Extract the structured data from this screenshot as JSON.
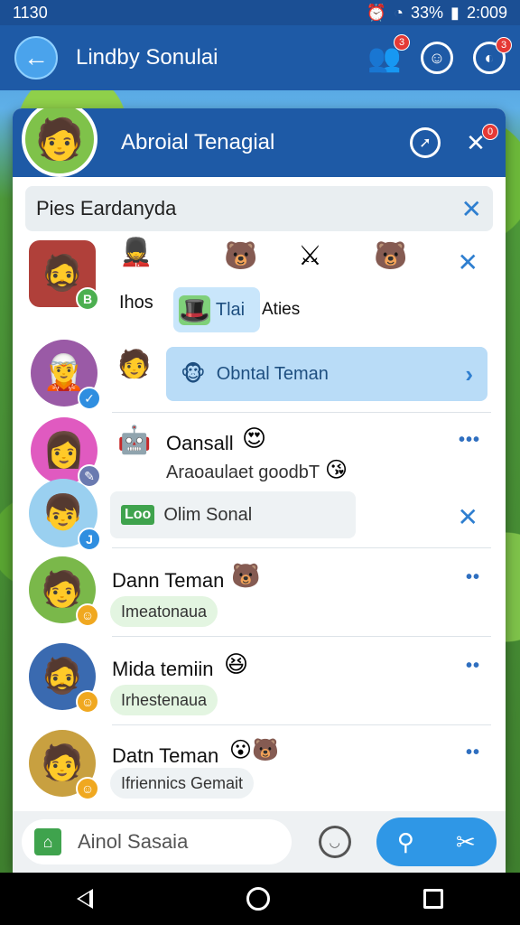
{
  "status": {
    "time": "1130",
    "battery": "33%",
    "clock": "2:009"
  },
  "appbar": {
    "title": "Lindby Sonulai",
    "friends_badge": "3",
    "notif_badge": "3"
  },
  "panel": {
    "title": "Abroial Tenagial",
    "close_badge": "0"
  },
  "search": {
    "value": "Pies Eardanyda"
  },
  "rows": {
    "r1": {
      "name": "Ihos",
      "chip": "Tlai",
      "chip_tail": "Aties",
      "badge": "B"
    },
    "r2": {
      "bubble": "Obntal Teman"
    },
    "r3": {
      "name": "Oansall",
      "sub": "Araoaulaet goodbT",
      "chip": "Olim Sonal",
      "chip_prefix": "Loo",
      "badge": "J"
    },
    "r4": {
      "name": "Dann Teman",
      "chip": "Imeatonaua"
    },
    "r5": {
      "name": "Mida temiin",
      "chip": "Irhestenaua"
    },
    "r6": {
      "name": "Datn Teman",
      "chip": "Ifriennics Gemait"
    }
  },
  "bottom": {
    "input_placeholder": "Ainol Sasaia"
  },
  "colors": {
    "primary": "#1e5aa6",
    "accent": "#2f97e6",
    "chip_green": "#e3f5e1"
  }
}
